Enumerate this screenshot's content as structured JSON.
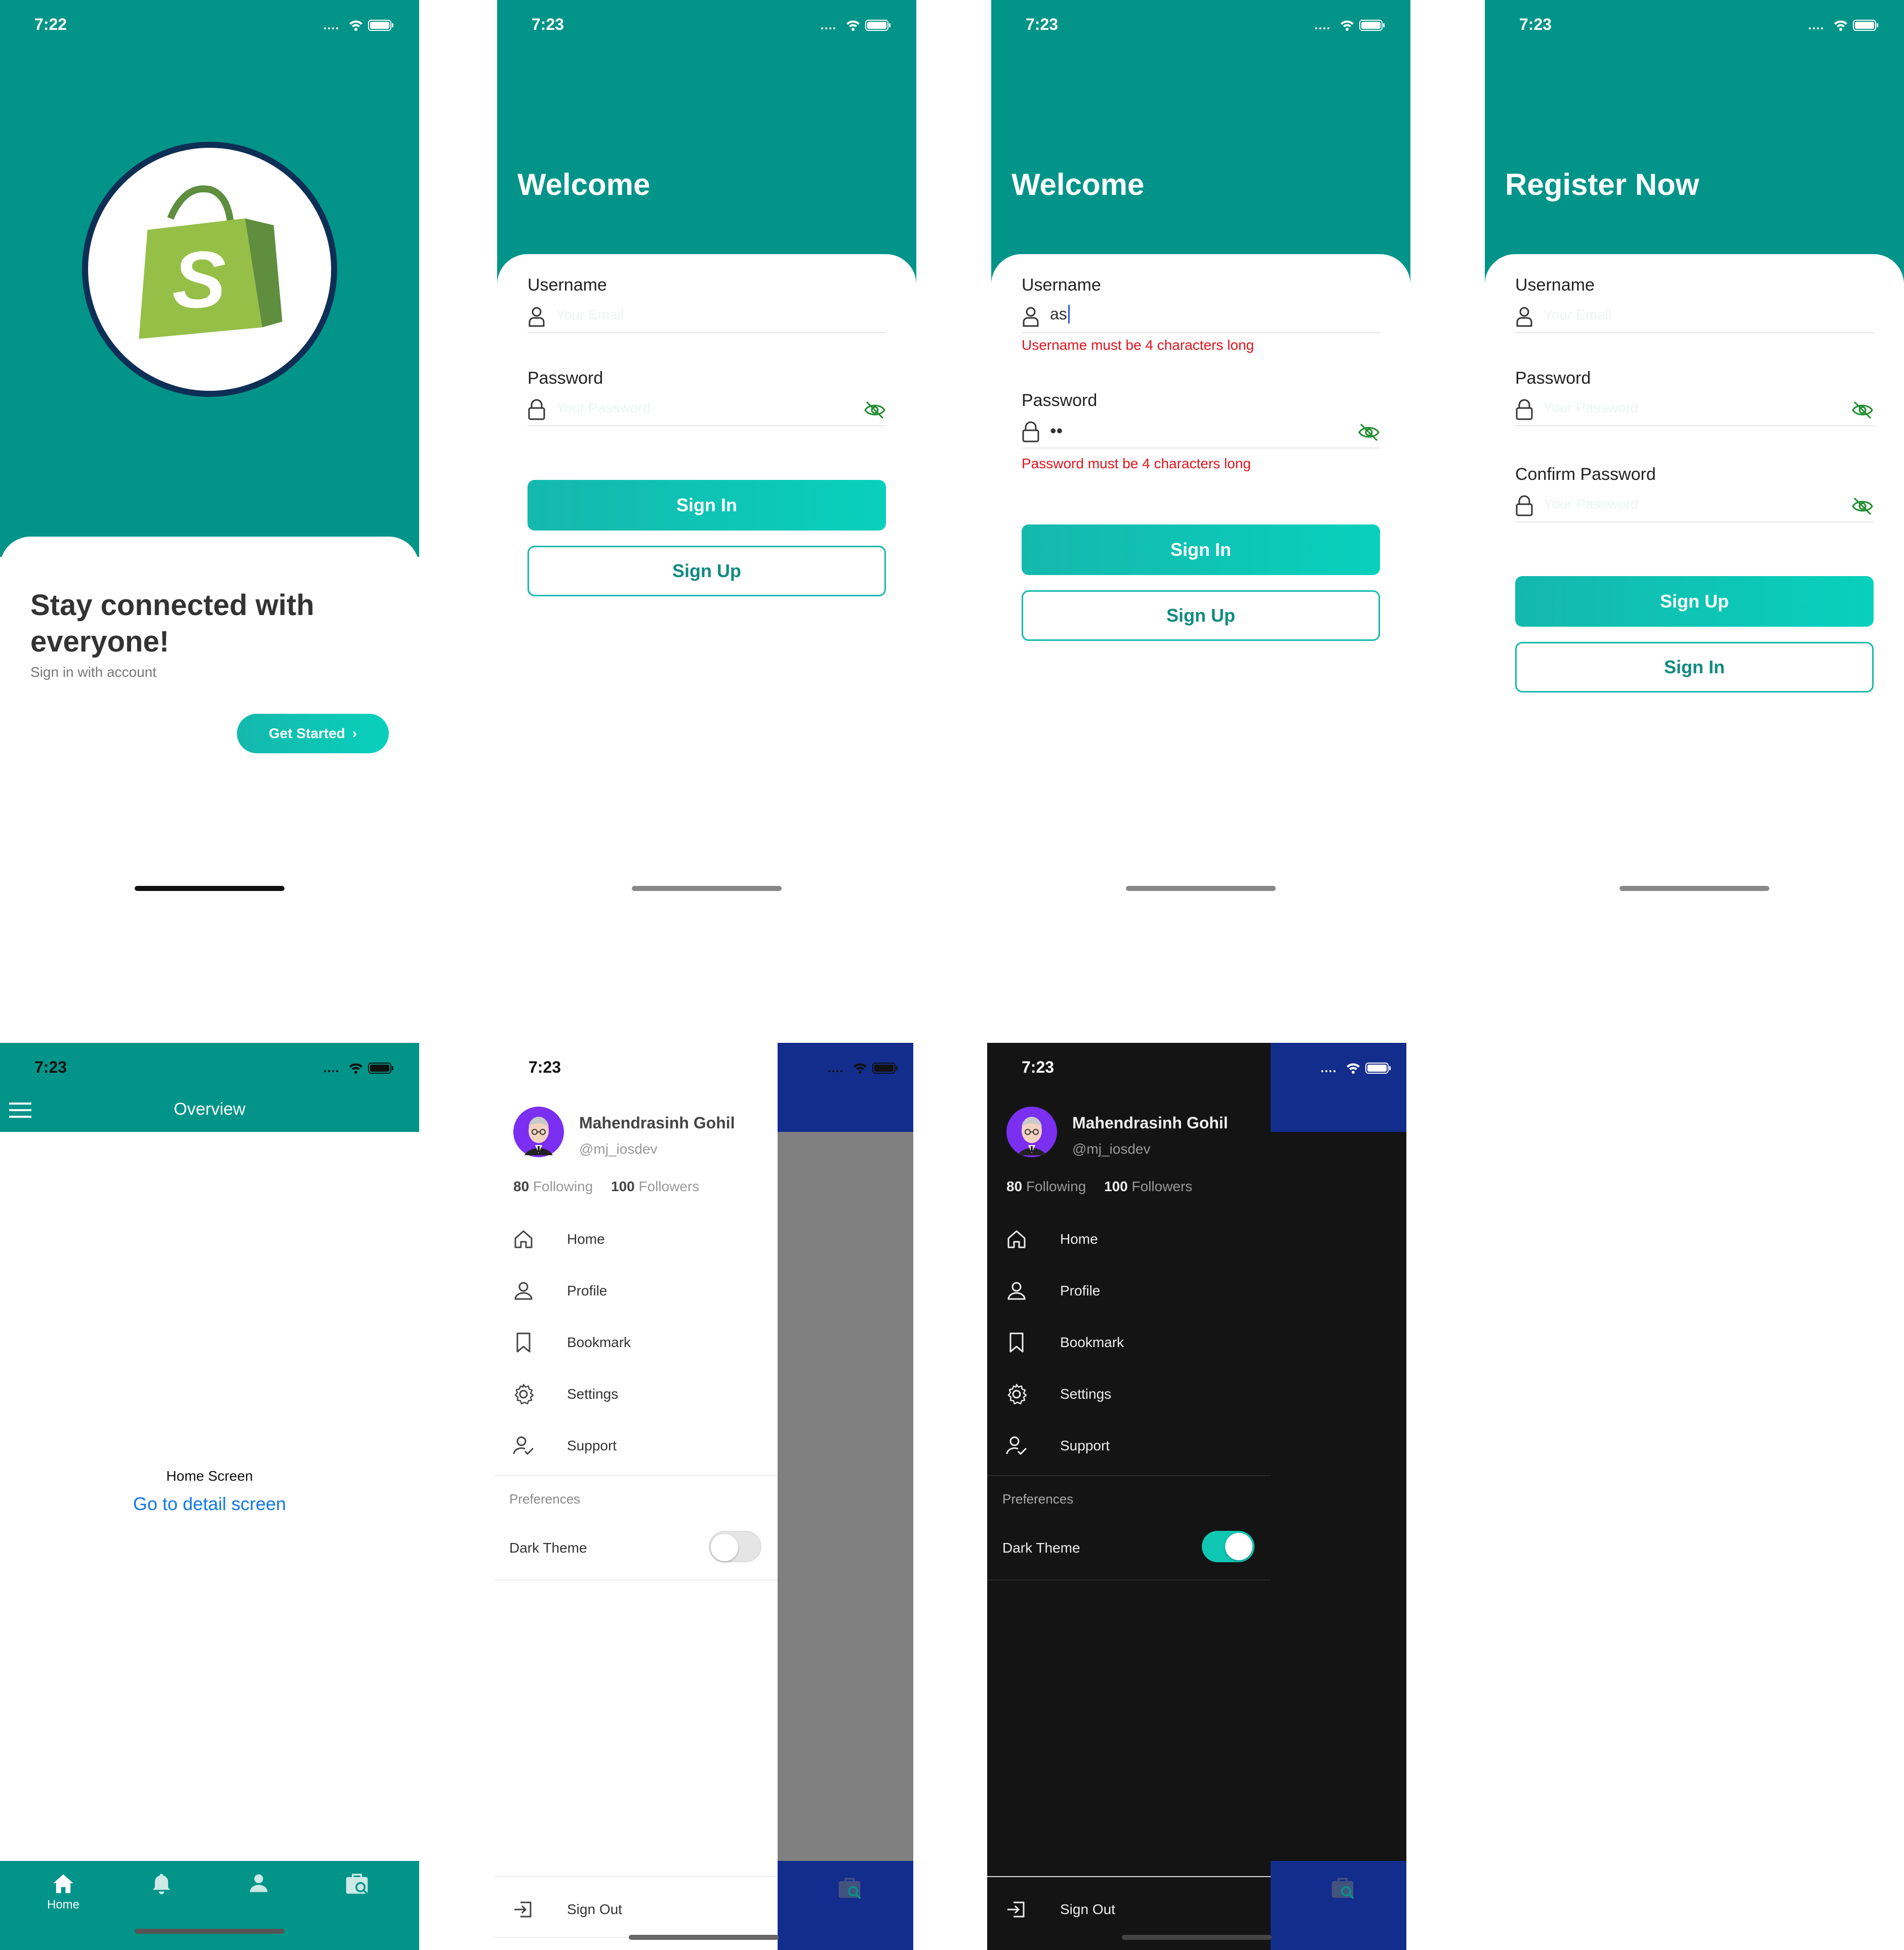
{
  "colors": {
    "teal": "#029488",
    "accent": "#15b8ad",
    "error": "#e0141e",
    "navy": "#122d8c",
    "dark": "#141414",
    "link": "#1077e6"
  },
  "splash": {
    "time": "7:22",
    "headline": "Stay connected with everyone!",
    "subtitle": "Sign in with account",
    "cta": "Get Started",
    "logo_letter": "S"
  },
  "login": {
    "time": "7:23",
    "title": "Welcome",
    "username_label": "Username",
    "username_placeholder": "Your Email",
    "password_label": "Password",
    "password_placeholder": "Your Password",
    "signin": "Sign In",
    "signup": "Sign Up"
  },
  "login_error": {
    "time": "7:23",
    "title": "Welcome",
    "username_label": "Username",
    "username_value": "as",
    "username_error": "Username must be 4 characters long",
    "password_label": "Password",
    "password_value": "••",
    "password_error": "Password must be 4 characters long",
    "signin": "Sign In",
    "signup": "Sign Up"
  },
  "register": {
    "time": "7:23",
    "title": "Register Now",
    "username_label": "Username",
    "username_placeholder": "Your Email",
    "password_label": "Password",
    "password_placeholder": "Your Password",
    "confirm_label": "Confirm Password",
    "confirm_placeholder": "Your Password",
    "signup": "Sign Up",
    "signin": "Sign In"
  },
  "overview": {
    "time": "7:23",
    "title": "Overview",
    "body_text": "Home Screen",
    "link": "Go to detail screen",
    "tabs": [
      {
        "label": "Home",
        "icon": "home-icon"
      },
      {
        "label": "",
        "icon": "bell-icon"
      },
      {
        "label": "",
        "icon": "person-icon"
      },
      {
        "label": "",
        "icon": "briefcase-search-icon"
      }
    ]
  },
  "drawer": {
    "time": "7:23",
    "name": "Mahendrasinh Gohil",
    "handle": "@mj_iosdev",
    "following_count": "80",
    "following_label": "Following",
    "followers_count": "100",
    "followers_label": "Followers",
    "items": [
      {
        "label": "Home",
        "icon": "home-icon"
      },
      {
        "label": "Profile",
        "icon": "person-icon"
      },
      {
        "label": "Bookmark",
        "icon": "bookmark-icon"
      },
      {
        "label": "Settings",
        "icon": "gear-icon"
      },
      {
        "label": "Support",
        "icon": "support-icon"
      }
    ],
    "preferences": "Preferences",
    "dark_theme": "Dark Theme",
    "sign_out": "Sign Out"
  },
  "toggles": {
    "light_dark_theme": false,
    "dark_dark_theme": true
  }
}
